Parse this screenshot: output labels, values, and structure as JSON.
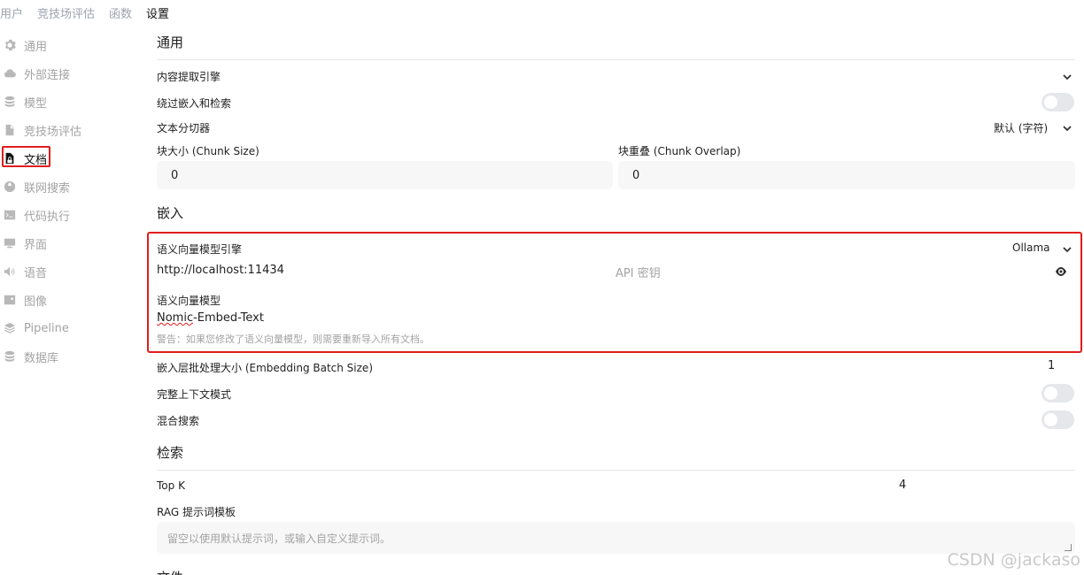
{
  "top_tabs": [
    "用户",
    "竞技场评估",
    "函数",
    "设置"
  ],
  "sidebar": {
    "items": [
      {
        "label": "通用",
        "icon": "gear-icon"
      },
      {
        "label": "外部连接",
        "icon": "cloud-icon"
      },
      {
        "label": "模型",
        "icon": "database-icon"
      },
      {
        "label": "竞技场评估",
        "icon": "document-icon"
      },
      {
        "label": "文档",
        "icon": "document-lock-icon",
        "active": true
      },
      {
        "label": "联网搜索",
        "icon": "globe-icon"
      },
      {
        "label": "代码执行",
        "icon": "terminal-icon"
      },
      {
        "label": "界面",
        "icon": "monitor-icon"
      },
      {
        "label": "语音",
        "icon": "speaker-icon"
      },
      {
        "label": "图像",
        "icon": "image-icon"
      },
      {
        "label": "Pipeline",
        "icon": "layers-icon"
      },
      {
        "label": "数据库",
        "icon": "database-icon"
      }
    ]
  },
  "general": {
    "title": "通用",
    "content_extraction_label": "内容提取引擎",
    "bypass_label": "绕过嵌入和检索",
    "splitter_label": "文本分切器",
    "splitter_value": "默认 (字符)",
    "chunk_size_label": "块大小 (Chunk Size)",
    "chunk_size_value": "0",
    "chunk_overlap_label": "块重叠 (Chunk Overlap)",
    "chunk_overlap_value": "0"
  },
  "embedding": {
    "title": "嵌入",
    "engine_label": "语义向量模型引擎",
    "engine_value": "Ollama",
    "url_value": "http://localhost:11434",
    "api_key_placeholder": "API 密钥",
    "model_label": "语义向量模型",
    "model_value_underlined": "Nomic",
    "model_value_rest": "-Embed-Text",
    "warning": "警告：如果您修改了语义向量模型，则需要重新导入所有文档。",
    "batch_label": "嵌入层批处理大小 (Embedding Batch Size)",
    "batch_value": "1",
    "full_context_label": "完整上下文模式",
    "hybrid_label": "混合搜索"
  },
  "retrieval": {
    "title": "检索",
    "topk_label": "Top K",
    "topk_value": "4",
    "rag_label": "RAG 提示词模板",
    "rag_placeholder": "留空以使用默认提示词，或输入自定义提示词。"
  },
  "next_section_title": "文件",
  "watermark": "CSDN @jackaso"
}
